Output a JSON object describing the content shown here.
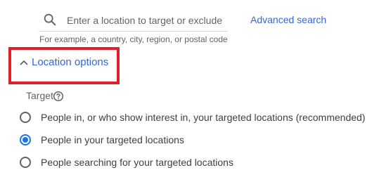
{
  "search": {
    "placeholder": "Enter a location to target or exclude",
    "value": "",
    "helper": "For example, a country, city, region, or postal code",
    "advanced_link": "Advanced search"
  },
  "location_options": {
    "label": "Location options",
    "expanded": true
  },
  "target": {
    "label": "Target",
    "options": [
      {
        "label": "People in, or who show interest in, your targeted locations (recommended)",
        "selected": false
      },
      {
        "label": "People in your targeted locations",
        "selected": true
      },
      {
        "label": "People searching for your targeted locations",
        "selected": false
      }
    ]
  },
  "colors": {
    "link": "#3367d6",
    "radio_selected": "#1a73e8",
    "highlight": "#e0202b"
  },
  "icons": [
    "search-icon",
    "chevron-up-icon",
    "help-icon"
  ]
}
